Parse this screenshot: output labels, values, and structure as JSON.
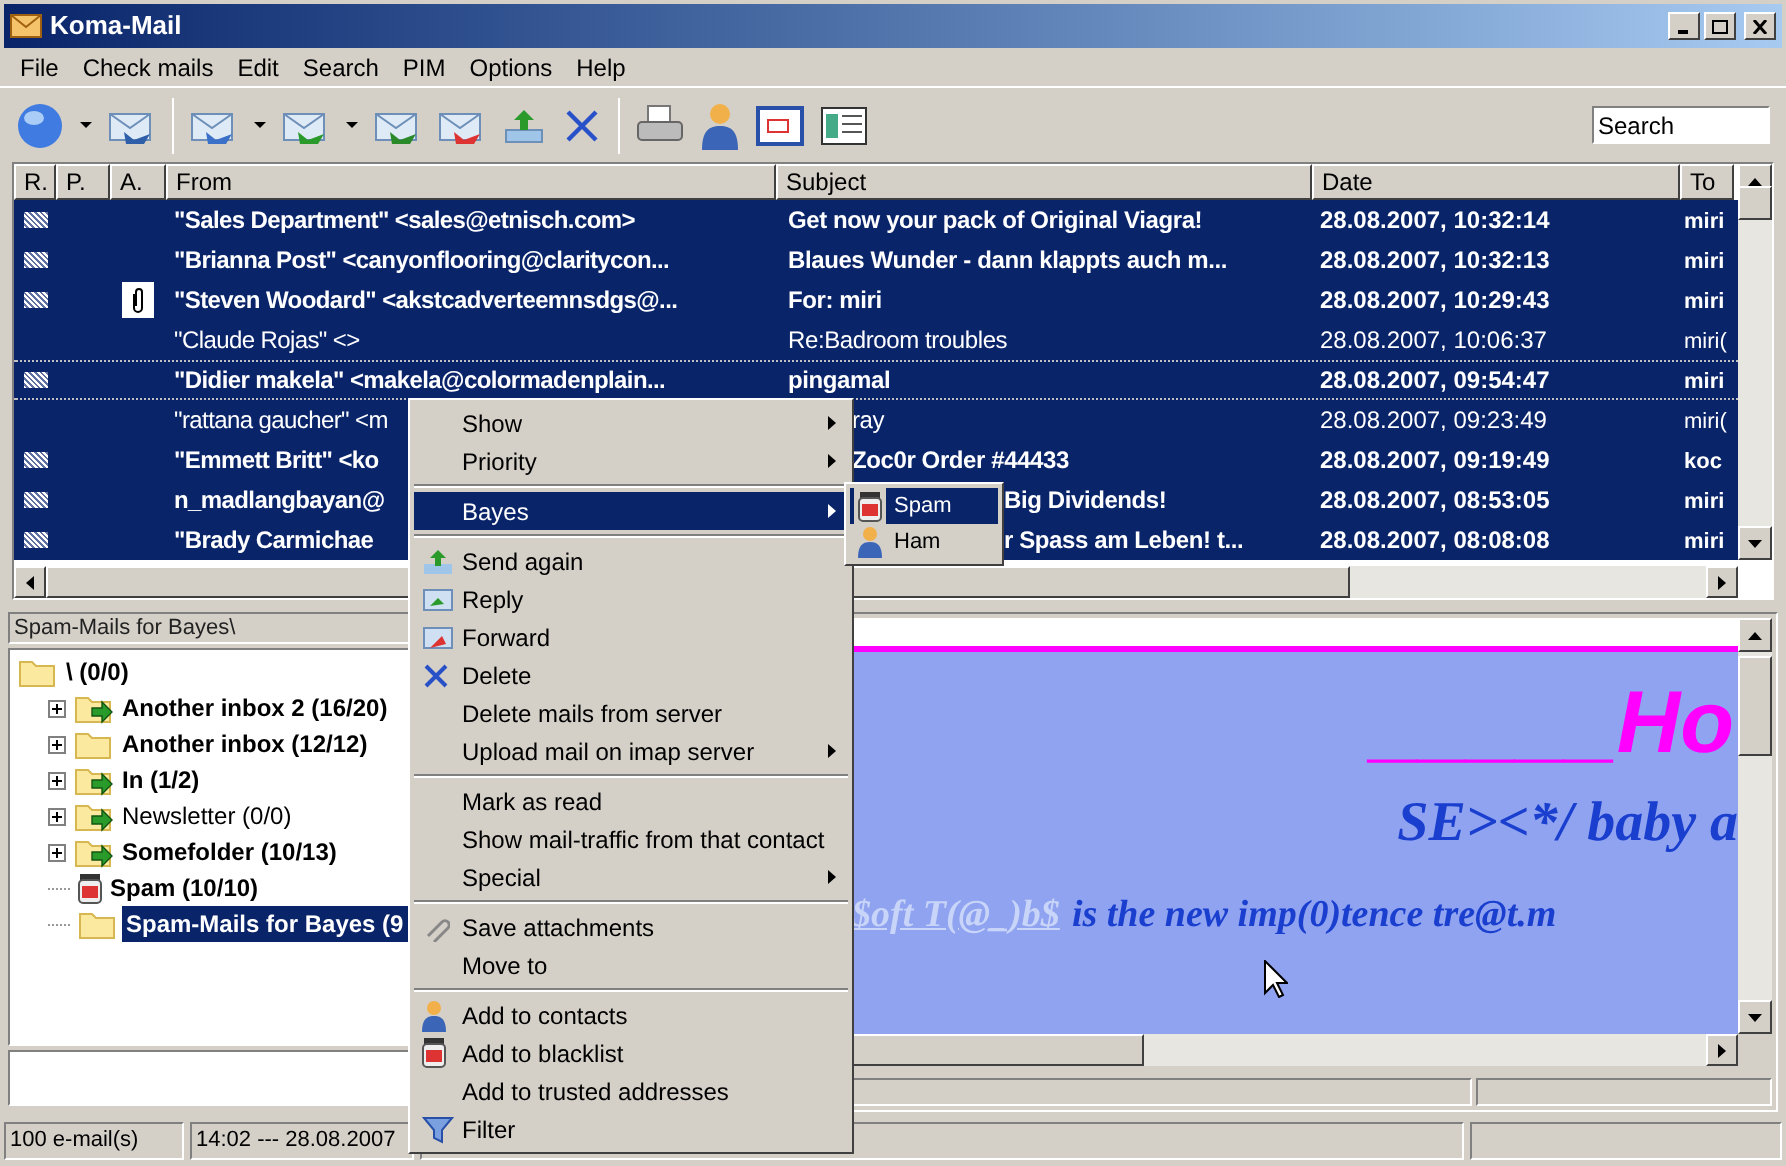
{
  "window": {
    "title": "Koma-Mail"
  },
  "menu": [
    "File",
    "Check mails",
    "Edit",
    "Search",
    "PIM",
    "Options",
    "Help"
  ],
  "search": {
    "placeholder": "Search"
  },
  "mail_list": {
    "columns": [
      "R.",
      "P.",
      "A.",
      "From",
      "Subject",
      "Date",
      "To"
    ],
    "rows": [
      {
        "from": "\"Sales Department\" <sales@etnisch.com>",
        "subject": "Get now your pack of Original Viagra!",
        "date": "28.08.2007, 10:32:14",
        "to": "miri",
        "unread": true,
        "attachment": false,
        "selected": true,
        "focused": false,
        "kind": "plain"
      },
      {
        "from": "\"Brianna Post\" <canyonflooring@claritycon...",
        "subject": "Blaues Wunder - dann klappts auch m...",
        "date": "28.08.2007, 10:32:13",
        "to": "miri",
        "unread": true,
        "attachment": false,
        "selected": true,
        "focused": false,
        "kind": "plain"
      },
      {
        "from": "\"Steven Woodard\" <akstcadverteemnsdgs@...",
        "subject": "For: miri",
        "date": "28.08.2007, 10:29:43",
        "to": "miri",
        "unread": true,
        "attachment": true,
        "selected": true,
        "focused": false,
        "kind": "plain"
      },
      {
        "from": "\"Claude Rojas\" <>",
        "subject": "Re:Badroom troubles",
        "date": "28.08.2007, 10:06:37",
        "to": "miri(",
        "unread": false,
        "attachment": false,
        "selected": true,
        "focused": false,
        "kind": "plain"
      },
      {
        "from": "\"Didier makela\" <makela@colormadenplain...",
        "subject": "pingamal",
        "date": "28.08.2007, 09:54:47",
        "to": "miri",
        "unread": true,
        "attachment": false,
        "selected": true,
        "focused": true,
        "kind": "plain"
      },
      {
        "from": "\"rattana gaucher\" <m",
        "subject": "ray",
        "date": "28.08.2007, 09:23:49",
        "to": "miri(",
        "unread": false,
        "attachment": false,
        "selected": true,
        "focused": false,
        "kind": "menu_overlap"
      },
      {
        "from": "\"Emmett Britt\" <ko",
        "subject": "Zoc0r Order #44433",
        "date": "28.08.2007, 09:19:49",
        "to": "koc",
        "unread": true,
        "attachment": false,
        "selected": true,
        "focused": false,
        "kind": "menu_overlap"
      },
      {
        "from": "n_madlangbayan@",
        "subject": "Big Dividends!",
        "date": "28.08.2007, 08:53:05",
        "to": "miri",
        "unread": true,
        "attachment": false,
        "selected": true,
        "focused": false,
        "kind": "submenu_overlap"
      },
      {
        "from": "\"Brady Carmichae",
        "subject": "r Spass am Leben!   t...",
        "date": "28.08.2007, 08:08:08",
        "to": "miri",
        "unread": true,
        "attachment": false,
        "selected": true,
        "focused": false,
        "kind": "submenu_overlap"
      }
    ]
  },
  "folder_path": "Spam-Mails for Bayes\\",
  "folders": [
    {
      "label": "\\ (0/0)",
      "kind": "folder",
      "unread": true,
      "selected": false,
      "children": [
        {
          "label": "Another inbox 2 (16/20)",
          "kind": "inbox",
          "unread": true,
          "selected": false,
          "expanded": false
        },
        {
          "label": "Another inbox (12/12)",
          "kind": "folder",
          "unread": true,
          "selected": false,
          "expanded": false
        },
        {
          "label": "In (1/2)",
          "kind": "inbox",
          "unread": true,
          "selected": false,
          "expanded": false
        },
        {
          "label": "Newsletter (0/0)",
          "kind": "inbox",
          "unread": false,
          "selected": false,
          "expanded": false
        },
        {
          "label": "Somefolder (10/13)",
          "kind": "inbox",
          "unread": true,
          "selected": false,
          "expanded": false
        },
        {
          "label": "Spam (10/10)",
          "kind": "spam",
          "unread": true,
          "selected": false
        },
        {
          "label": "Spam-Mails for Bayes (9",
          "kind": "folder",
          "unread": true,
          "selected": true
        }
      ]
    }
  ],
  "preview": {
    "heading": "_____Ho",
    "subheading": "SE><*/ baby a",
    "link": "$oft T(@_)b$",
    "text": "is the new imp(0)tence tre@t.m"
  },
  "context_menu": {
    "items": [
      {
        "kind": "item",
        "label": "Show",
        "submenu": true,
        "selected": false
      },
      {
        "kind": "item",
        "label": "Priority",
        "submenu": true,
        "selected": false
      },
      {
        "kind": "separator"
      },
      {
        "kind": "item",
        "label": "Bayes",
        "submenu": true,
        "selected": true
      },
      {
        "kind": "separator"
      },
      {
        "kind": "item",
        "label": "Send again",
        "submenu": false,
        "selected": false
      },
      {
        "kind": "item",
        "label": "Reply",
        "submenu": false,
        "selected": false
      },
      {
        "kind": "item",
        "label": "Forward",
        "submenu": false,
        "selected": false
      },
      {
        "kind": "item",
        "label": "Delete",
        "submenu": false,
        "selected": false
      },
      {
        "kind": "item",
        "label": "Delete mails from server",
        "submenu": false,
        "selected": false
      },
      {
        "kind": "item",
        "label": "Upload mail on imap server",
        "submenu": true,
        "selected": false
      },
      {
        "kind": "separator"
      },
      {
        "kind": "item",
        "label": "Mark as read",
        "submenu": false,
        "selected": false
      },
      {
        "kind": "item",
        "label": "Show mail-traffic from that contact",
        "submenu": false,
        "selected": false
      },
      {
        "kind": "item",
        "label": "Special",
        "submenu": true,
        "selected": false
      },
      {
        "kind": "separator"
      },
      {
        "kind": "item",
        "label": "Save attachments",
        "submenu": false,
        "selected": false
      },
      {
        "kind": "item",
        "label": "Move to",
        "submenu": false,
        "selected": false
      },
      {
        "kind": "separator"
      },
      {
        "kind": "item",
        "label": "Add to contacts",
        "submenu": false,
        "selected": false
      },
      {
        "kind": "item",
        "label": "Add to blacklist",
        "submenu": false,
        "selected": false
      },
      {
        "kind": "item",
        "label": "Add to trusted addresses",
        "submenu": false,
        "selected": false
      },
      {
        "kind": "item",
        "label": "Filter",
        "submenu": false,
        "selected": false
      }
    ]
  },
  "submenu": {
    "items": [
      {
        "label": "Spam",
        "kind": "spam",
        "selected": true
      },
      {
        "label": "Ham",
        "kind": "contact",
        "selected": false
      }
    ]
  },
  "status_bar": [
    "100 e-mail(s)",
    "14:02 --- 28.08.2007"
  ]
}
